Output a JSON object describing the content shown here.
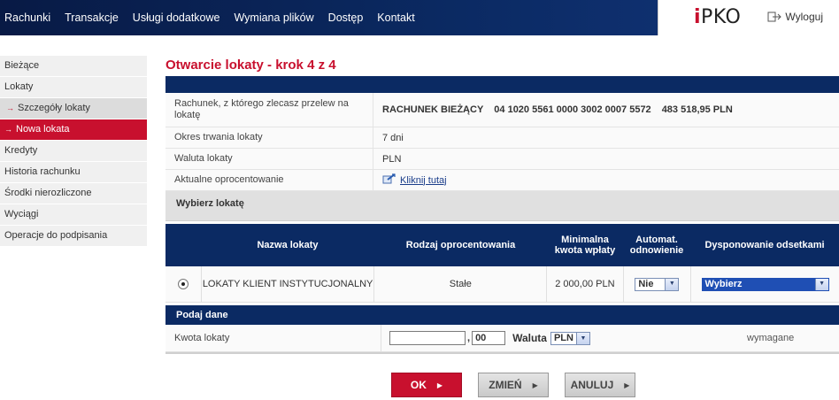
{
  "nav": {
    "items": [
      "Rachunki",
      "Transakcje",
      "Usługi dodatkowe",
      "Wymiana plików",
      "Dostęp",
      "Kontakt"
    ]
  },
  "brand": {
    "logo_i": "i",
    "logo_rest": "PKO",
    "logout": "Wyloguj"
  },
  "sidebar": {
    "items": [
      {
        "label": "Bieżące"
      },
      {
        "label": "Lokaty"
      },
      {
        "label": "Szczegóły lokaty",
        "arrow": "→"
      },
      {
        "label": "Nowa lokata",
        "arrow": "→"
      },
      {
        "label": "Kredyty"
      },
      {
        "label": "Historia rachunku"
      },
      {
        "label": "Środki nierozliczone"
      },
      {
        "label": "Wyciągi"
      },
      {
        "label": "Operacje do podpisania"
      }
    ]
  },
  "main": {
    "title": "Otwarcie lokaty - krok 4 z 4",
    "account": {
      "label": "Rachunek, z którego zlecasz przelew na lokatę",
      "name": "RACHUNEK BIEŻĄCY",
      "number": "04 1020 5561 0000 3002 0007 5572",
      "balance": "483 518,95 PLN"
    },
    "period": {
      "label": "Okres trwania lokaty",
      "value": "7 dni"
    },
    "currency": {
      "label": "Waluta lokaty",
      "value": "PLN"
    },
    "interest": {
      "label": "Aktualne oprocentowanie",
      "link": "Kliknij tutaj"
    },
    "choose_header": "Wybierz lokatę",
    "table": {
      "headers": [
        "Nazwa lokaty",
        "Rodzaj oprocentowania",
        "Minimalna kwota wpłaty",
        "Automat. odnowienie",
        "Dysponowanie odsetkami"
      ],
      "row": {
        "name": "LOKATY KLIENT INSTYTUCJONALNY",
        "rate_type": "Stałe",
        "min_amount": "2 000,00 PLN",
        "renewal": "Nie",
        "interest_disposal": "Wybierz"
      }
    },
    "data_header": "Podaj dane",
    "amount": {
      "label": "Kwota lokaty",
      "value": "",
      "decimals": "00",
      "currency_label": "Waluta",
      "currency": "PLN",
      "required": "wymagane"
    }
  },
  "buttons": {
    "ok": "OK",
    "change": "ZMIEŃ",
    "cancel": "ANULUJ"
  }
}
